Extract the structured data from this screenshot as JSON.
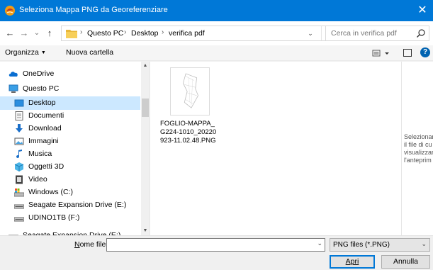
{
  "window": {
    "title": "Seleziona Mappa PNG da Georeferenziare",
    "close_glyph": "✕",
    "app_icon": "app-icon"
  },
  "nav": {
    "back_glyph": "←",
    "forward_glyph": "→",
    "recent_glyph": "⌄",
    "up_glyph": "↑",
    "breadcrumb": [
      "Questo PC",
      "Desktop",
      "verifica pdf"
    ],
    "dropdown_glyph": "⌄",
    "refresh_glyph": "↻",
    "search_placeholder": "Cerca in verifica pdf"
  },
  "toolbar": {
    "organize_label": "Organizza",
    "new_folder_label": "Nuova cartella",
    "help_glyph": "?"
  },
  "sidebar": {
    "items": [
      {
        "label": "OneDrive",
        "icon": "cloud-icon",
        "indent": 0
      },
      {
        "label": "Questo PC",
        "icon": "computer-icon",
        "indent": 0
      },
      {
        "label": "Desktop",
        "icon": "desktop-icon",
        "indent": 1,
        "selected": true
      },
      {
        "label": "Documenti",
        "icon": "documents-icon",
        "indent": 1
      },
      {
        "label": "Download",
        "icon": "download-icon",
        "indent": 1
      },
      {
        "label": "Immagini",
        "icon": "pictures-icon",
        "indent": 1
      },
      {
        "label": "Musica",
        "icon": "music-icon",
        "indent": 1
      },
      {
        "label": "Oggetti 3D",
        "icon": "3d-objects-icon",
        "indent": 1
      },
      {
        "label": "Video",
        "icon": "video-icon",
        "indent": 1
      },
      {
        "label": "Windows (C:)",
        "icon": "drive-c-icon",
        "indent": 1
      },
      {
        "label": "Seagate Expansion Drive (E:)",
        "icon": "drive-icon",
        "indent": 1
      },
      {
        "label": "UDINO1TB (F:)",
        "icon": "drive-icon",
        "indent": 1
      },
      {
        "label": "Seagate Expansion Drive (E:)",
        "icon": "drive-icon",
        "indent": 0
      }
    ]
  },
  "files": [
    {
      "name_lines": [
        "FOGLIO-MAPPA_",
        "G224-1010_20220",
        "923-11.02.48.PNG"
      ],
      "icon": "png-thumbnail-icon"
    }
  ],
  "preview": {
    "lines": [
      "Selezionar",
      "il file di cu",
      "visualizzar",
      "l'anteprim"
    ]
  },
  "bottom": {
    "filename_label": "Nome file:",
    "filename_value": "",
    "filter_value": "PNG files (*.PNG)",
    "open_label": "Apri",
    "cancel_label": "Annulla"
  },
  "colors": {
    "accent": "#0078d7",
    "selection": "#cce8ff"
  }
}
